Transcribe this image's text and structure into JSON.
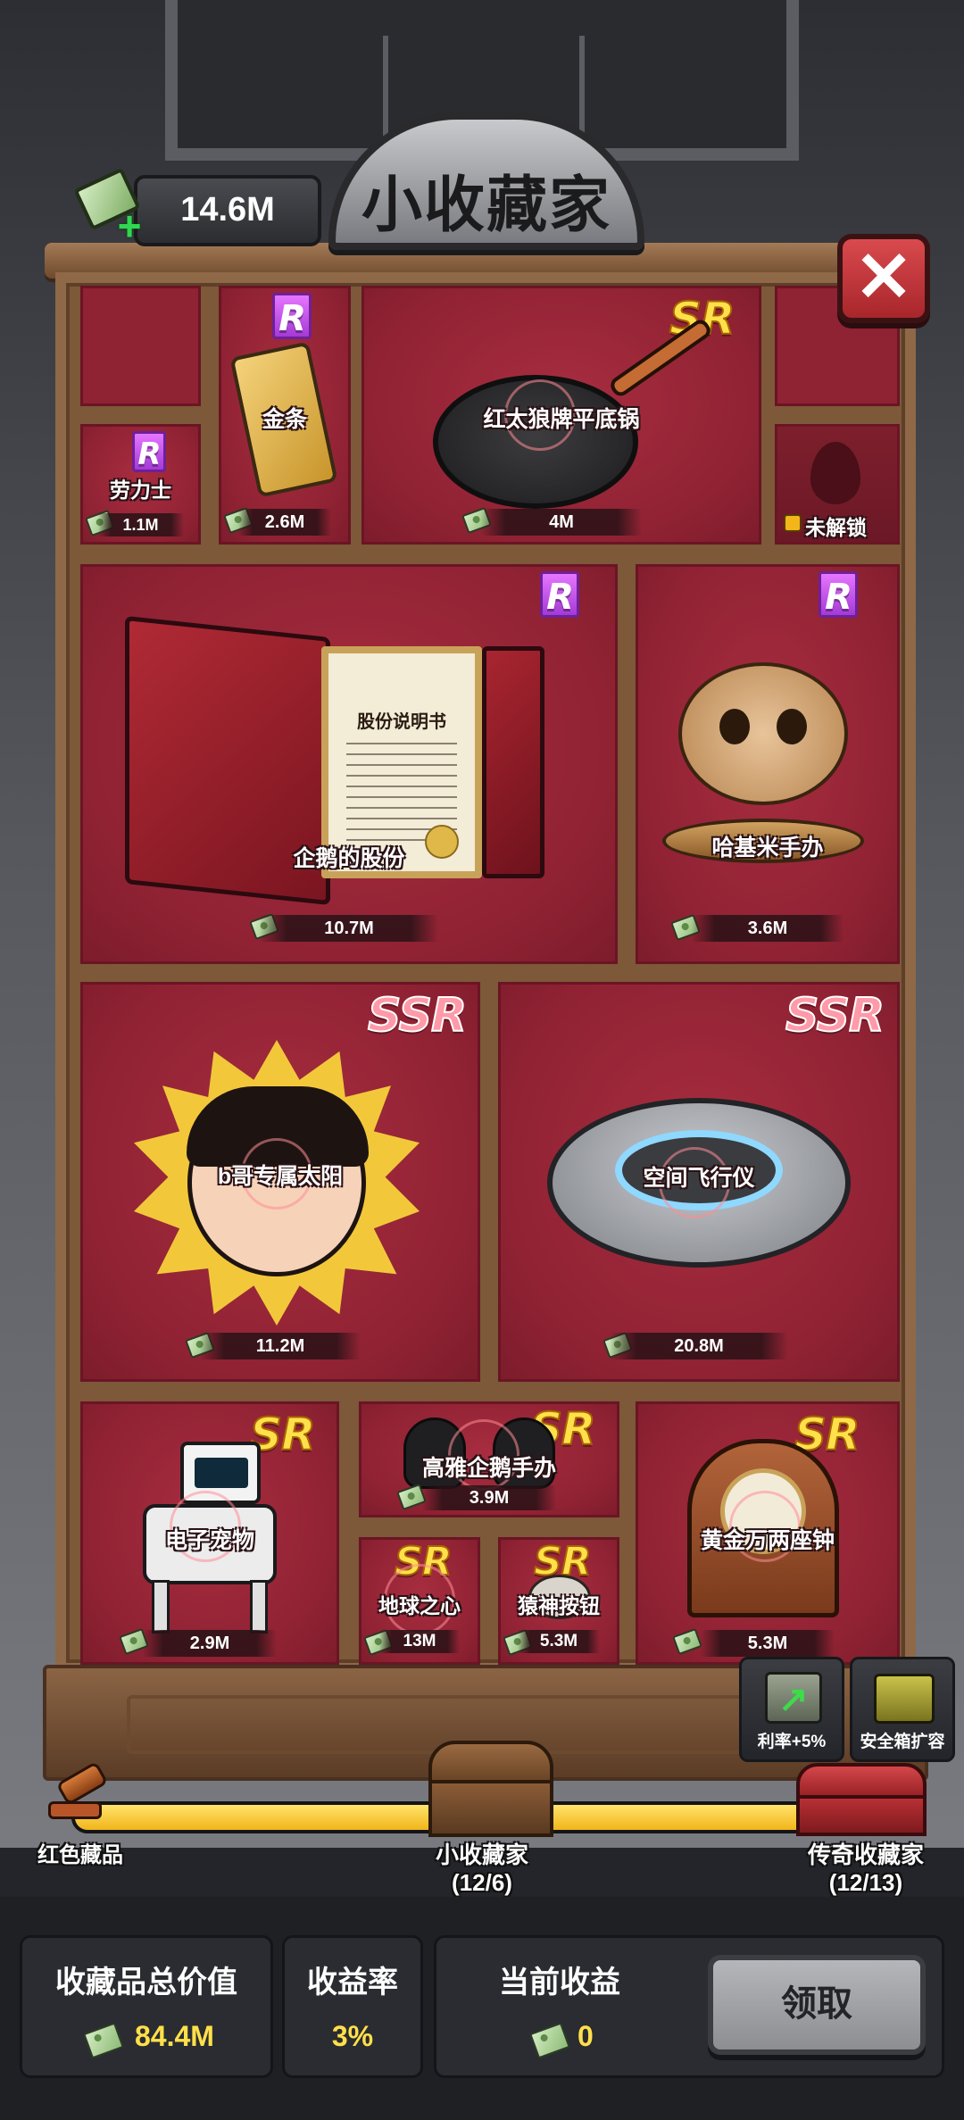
{
  "header": {
    "cash": "14.6M",
    "title": "小收藏家",
    "cash_icon": "money-plus-icon",
    "close_icon": "close-icon"
  },
  "items": {
    "rolex": {
      "name": "劳力士",
      "rarity": "R",
      "value": "1.1M"
    },
    "gold_bar": {
      "name": "金条",
      "rarity": "R",
      "value": "2.6M"
    },
    "frying_pan": {
      "name": "红太狼牌平底锅",
      "rarity": "SR",
      "value": "4M"
    },
    "locked": {
      "label": "未解锁",
      "icon": "lock-icon"
    },
    "penguin_shares": {
      "name": "企鹅的股份",
      "rarity": "R",
      "value": "10.7M",
      "doc_title": "股份说明书"
    },
    "hakimi": {
      "name": "哈基米手办",
      "rarity": "R",
      "value": "3.6M"
    },
    "sun": {
      "name": "b哥专属太阳",
      "rarity": "SSR",
      "value": "11.2M"
    },
    "spacecraft": {
      "name": "空间飞行仪",
      "rarity": "SSR",
      "value": "20.8M"
    },
    "robot_pet": {
      "name": "电子宠物",
      "rarity": "SR",
      "value": "2.9M"
    },
    "penguin_figure": {
      "name": "高雅企鹅手办",
      "rarity": "SR",
      "value": "3.9M"
    },
    "earth_heart": {
      "name": "地球之心",
      "rarity": "SR",
      "value": "13M"
    },
    "monkey_button": {
      "name": "猿神按钮",
      "rarity": "SR",
      "value": "5.3M"
    },
    "clock": {
      "name": "黄金万两座钟",
      "rarity": "SR",
      "value": "5.3M"
    }
  },
  "upgrades": {
    "rate": {
      "label": "利率+5%",
      "icon": "rate-up-icon"
    },
    "safe": {
      "label": "安全箱扩容",
      "icon": "safe-icon"
    }
  },
  "progress": {
    "left_label": "红色藏品",
    "mid_label": "小收藏家",
    "mid_count": "(12/6)",
    "right_label": "传奇收藏家",
    "right_count": "(12/13)",
    "fill_fraction": 1.0
  },
  "stats": {
    "total_title": "收藏品总价值",
    "total_value": "84.4M",
    "rate_title": "收益率",
    "rate_value": "3%",
    "income_title": "当前收益",
    "income_value": "0"
  },
  "claim_label": "领取"
}
